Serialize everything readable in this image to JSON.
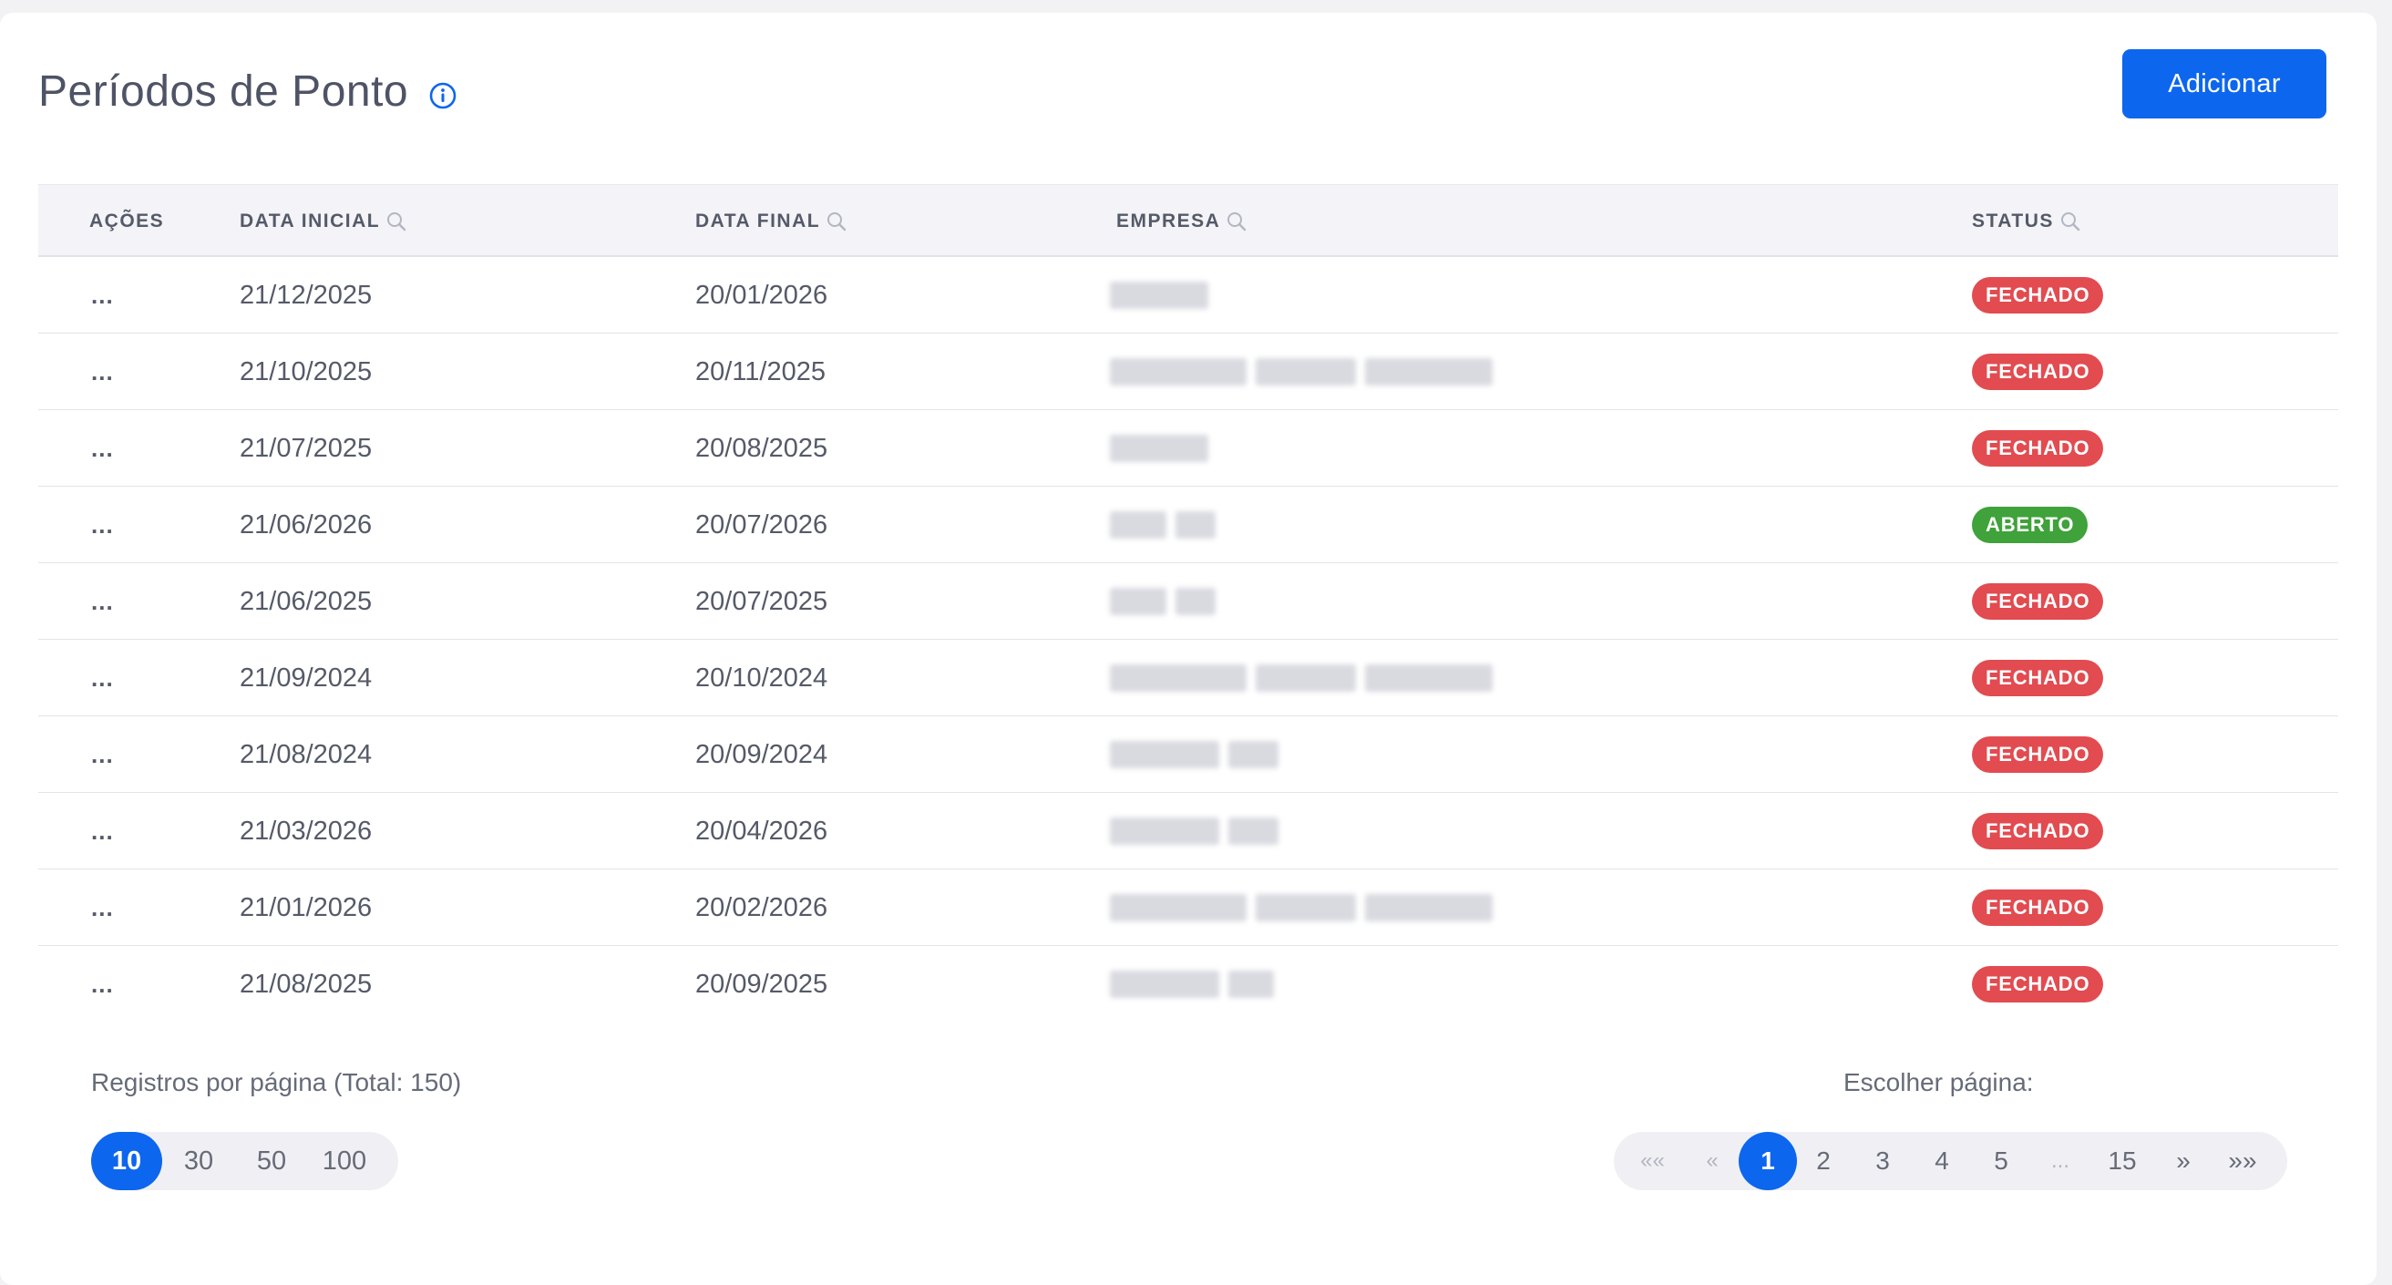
{
  "header": {
    "title": "Períodos de Ponto",
    "info_icon": "info-icon",
    "add_label": "Adicionar"
  },
  "table": {
    "columns": {
      "actions": "AÇÕES",
      "start": "DATA INICIAL",
      "end": "DATA FINAL",
      "company": "EMPRESA",
      "status": "STATUS"
    },
    "rows": [
      {
        "actions": "...",
        "start": "21/12/2025",
        "end": "20/01/2026",
        "status": "FECHADO"
      },
      {
        "actions": "...",
        "start": "21/10/2025",
        "end": "20/11/2025",
        "status": "FECHADO"
      },
      {
        "actions": "...",
        "start": "21/07/2025",
        "end": "20/08/2025",
        "status": "FECHADO"
      },
      {
        "actions": "...",
        "start": "21/06/2026",
        "end": "20/07/2026",
        "status": "ABERTO"
      },
      {
        "actions": "...",
        "start": "21/06/2025",
        "end": "20/07/2025",
        "status": "FECHADO"
      },
      {
        "actions": "...",
        "start": "21/09/2024",
        "end": "20/10/2024",
        "status": "FECHADO"
      },
      {
        "actions": "...",
        "start": "21/08/2024",
        "end": "20/09/2024",
        "status": "FECHADO"
      },
      {
        "actions": "...",
        "start": "21/03/2026",
        "end": "20/04/2026",
        "status": "FECHADO"
      },
      {
        "actions": "...",
        "start": "21/01/2026",
        "end": "20/02/2026",
        "status": "FECHADO"
      },
      {
        "actions": "...",
        "start": "21/08/2025",
        "end": "20/09/2025",
        "status": "FECHADO"
      }
    ],
    "status_colors": {
      "FECHADO": "#e24b50",
      "ABERTO": "#3fa23a"
    }
  },
  "footer": {
    "per_page_label": "Registros por página (Total: 150)",
    "per_page_options": [
      "10",
      "30",
      "50",
      "100"
    ],
    "per_page_selected": "10",
    "choose_page_label": "Escolher página:",
    "pages": [
      "««",
      "«",
      "1",
      "2",
      "3",
      "4",
      "5",
      "...",
      "15",
      "»",
      "»»"
    ],
    "current_page": "1"
  },
  "colors": {
    "accent": "#0d66ee"
  }
}
